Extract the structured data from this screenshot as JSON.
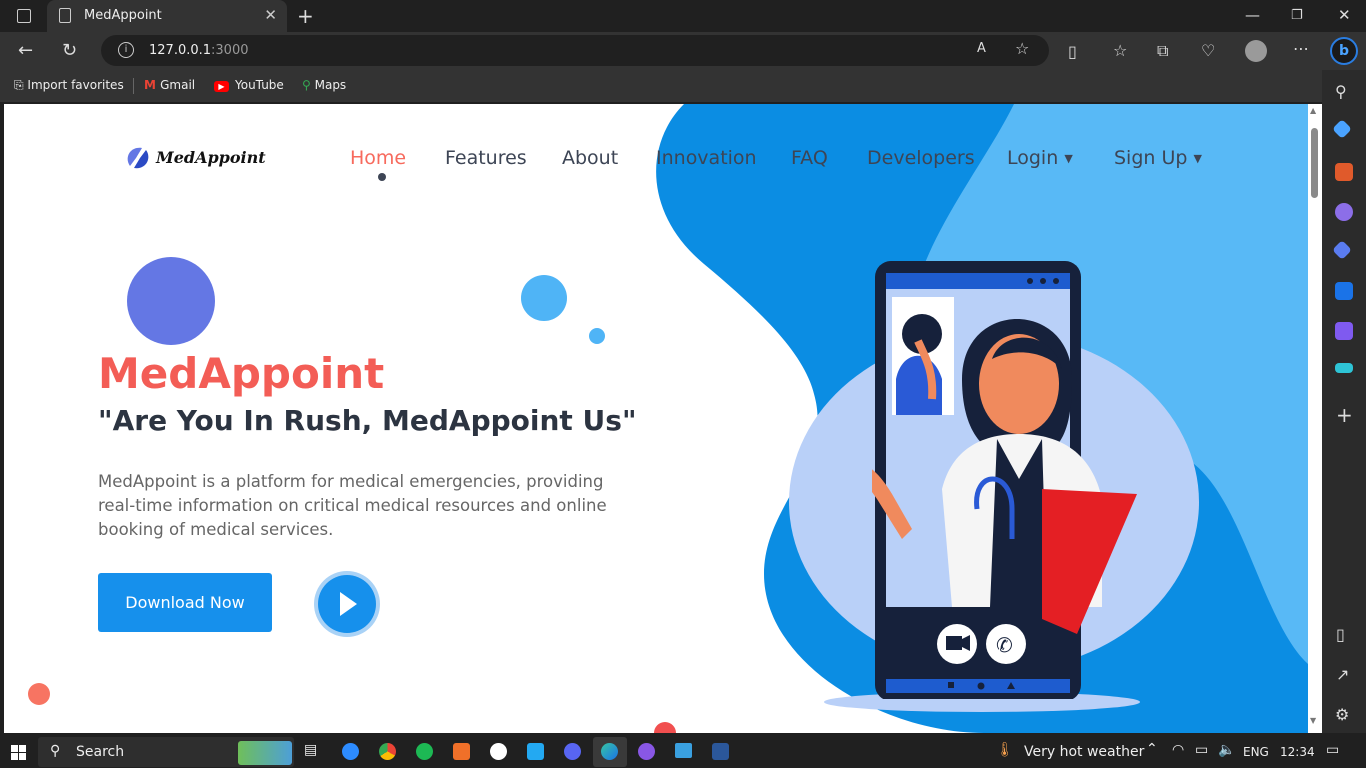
{
  "browser": {
    "tab_title": "MedAppoint",
    "url_host": "127.0.0.1",
    "url_port": ":3000",
    "favorites": [
      {
        "label": "Import favorites",
        "icon": "import-icon"
      },
      {
        "label": "Gmail",
        "icon": "gmail-icon"
      },
      {
        "label": "YouTube",
        "icon": "youtube-icon"
      },
      {
        "label": "Maps",
        "icon": "maps-icon"
      }
    ]
  },
  "site": {
    "logo_text": "MedAppoint",
    "nav": [
      "Home",
      "Features",
      "About",
      "Innovation",
      "FAQ",
      "Developers",
      "Login",
      "Sign Up"
    ],
    "active_nav": "Home",
    "hero": {
      "title": "MedAppoint",
      "subtitle": "\"Are You In Rush, MedAppoint Us\"",
      "description": "MedAppoint is a platform for medical emergencies, providing real-time information on critical medical resources and online booking of medical services.",
      "cta": "Download Now"
    },
    "colors": {
      "accent": "#1690ec",
      "brand_red": "#f35d56",
      "blob_blue": "#0b8de3",
      "light_blue": "#b9d0f8"
    }
  },
  "taskbar": {
    "search": "Search",
    "weather": "Very hot weather",
    "lang": "ENG",
    "time": "12:34"
  }
}
